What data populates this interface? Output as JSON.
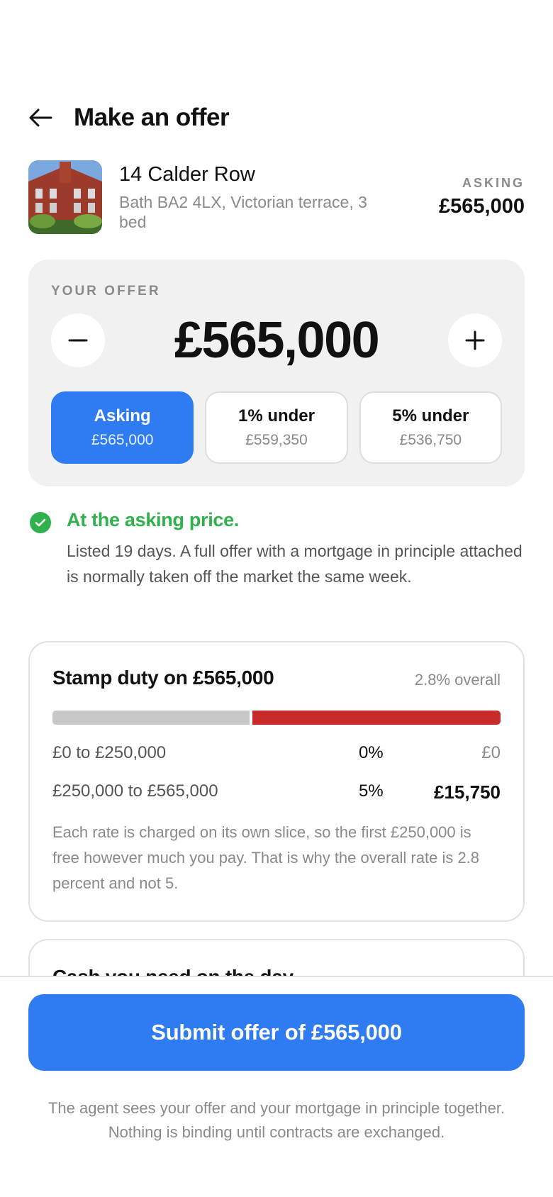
{
  "header": {
    "title": "Make an offer",
    "back_icon": "arrow-left-icon"
  },
  "listing": {
    "title": "14 Calder Row",
    "subtitle": "Bath BA2 4LX, Victorian terrace, 3 bed",
    "asking_label": "ASKING",
    "asking_value": "£565,000"
  },
  "offer": {
    "label": "YOUR OFFER",
    "amount": "£565,000",
    "presets": [
      {
        "label": "Asking",
        "value": "£565,000",
        "active": true
      },
      {
        "label": "1% under",
        "value": "£559,350",
        "active": false
      },
      {
        "label": "5% under",
        "value": "£536,750",
        "active": false
      }
    ]
  },
  "status": {
    "title": "At the asking price.",
    "body": "Listed 19 days. A full offer with a mortgage in principle attached is normally taken off the market the same week.",
    "color": "#2fb14d"
  },
  "stamp_duty": {
    "title": "Stamp duty on £565,000",
    "overall": "2.8% overall",
    "bar": {
      "free_fraction": 0.443,
      "taxed_fraction": 0.557
    },
    "bands": [
      {
        "range": "£0 to £250,000",
        "rate": "0%",
        "amount": "£0"
      },
      {
        "range": "£250,000 to £565,000",
        "rate": "5%",
        "amount": "£15,750"
      }
    ],
    "note": "Each rate is charged on its own slice, so the first £250,000 is free however much you pay. That is why the overall rate is 2.8 percent and not 5."
  },
  "cash": {
    "title": "Cash you need on the day"
  },
  "footer": {
    "submit_label": "Submit offer of £565,000",
    "note": "The agent sees your offer and your mortgage in principle together. Nothing is binding until contracts are exchanged."
  },
  "colors": {
    "accent": "#2f7cf2",
    "success": "#2fb14d",
    "danger": "#c92a2a"
  }
}
